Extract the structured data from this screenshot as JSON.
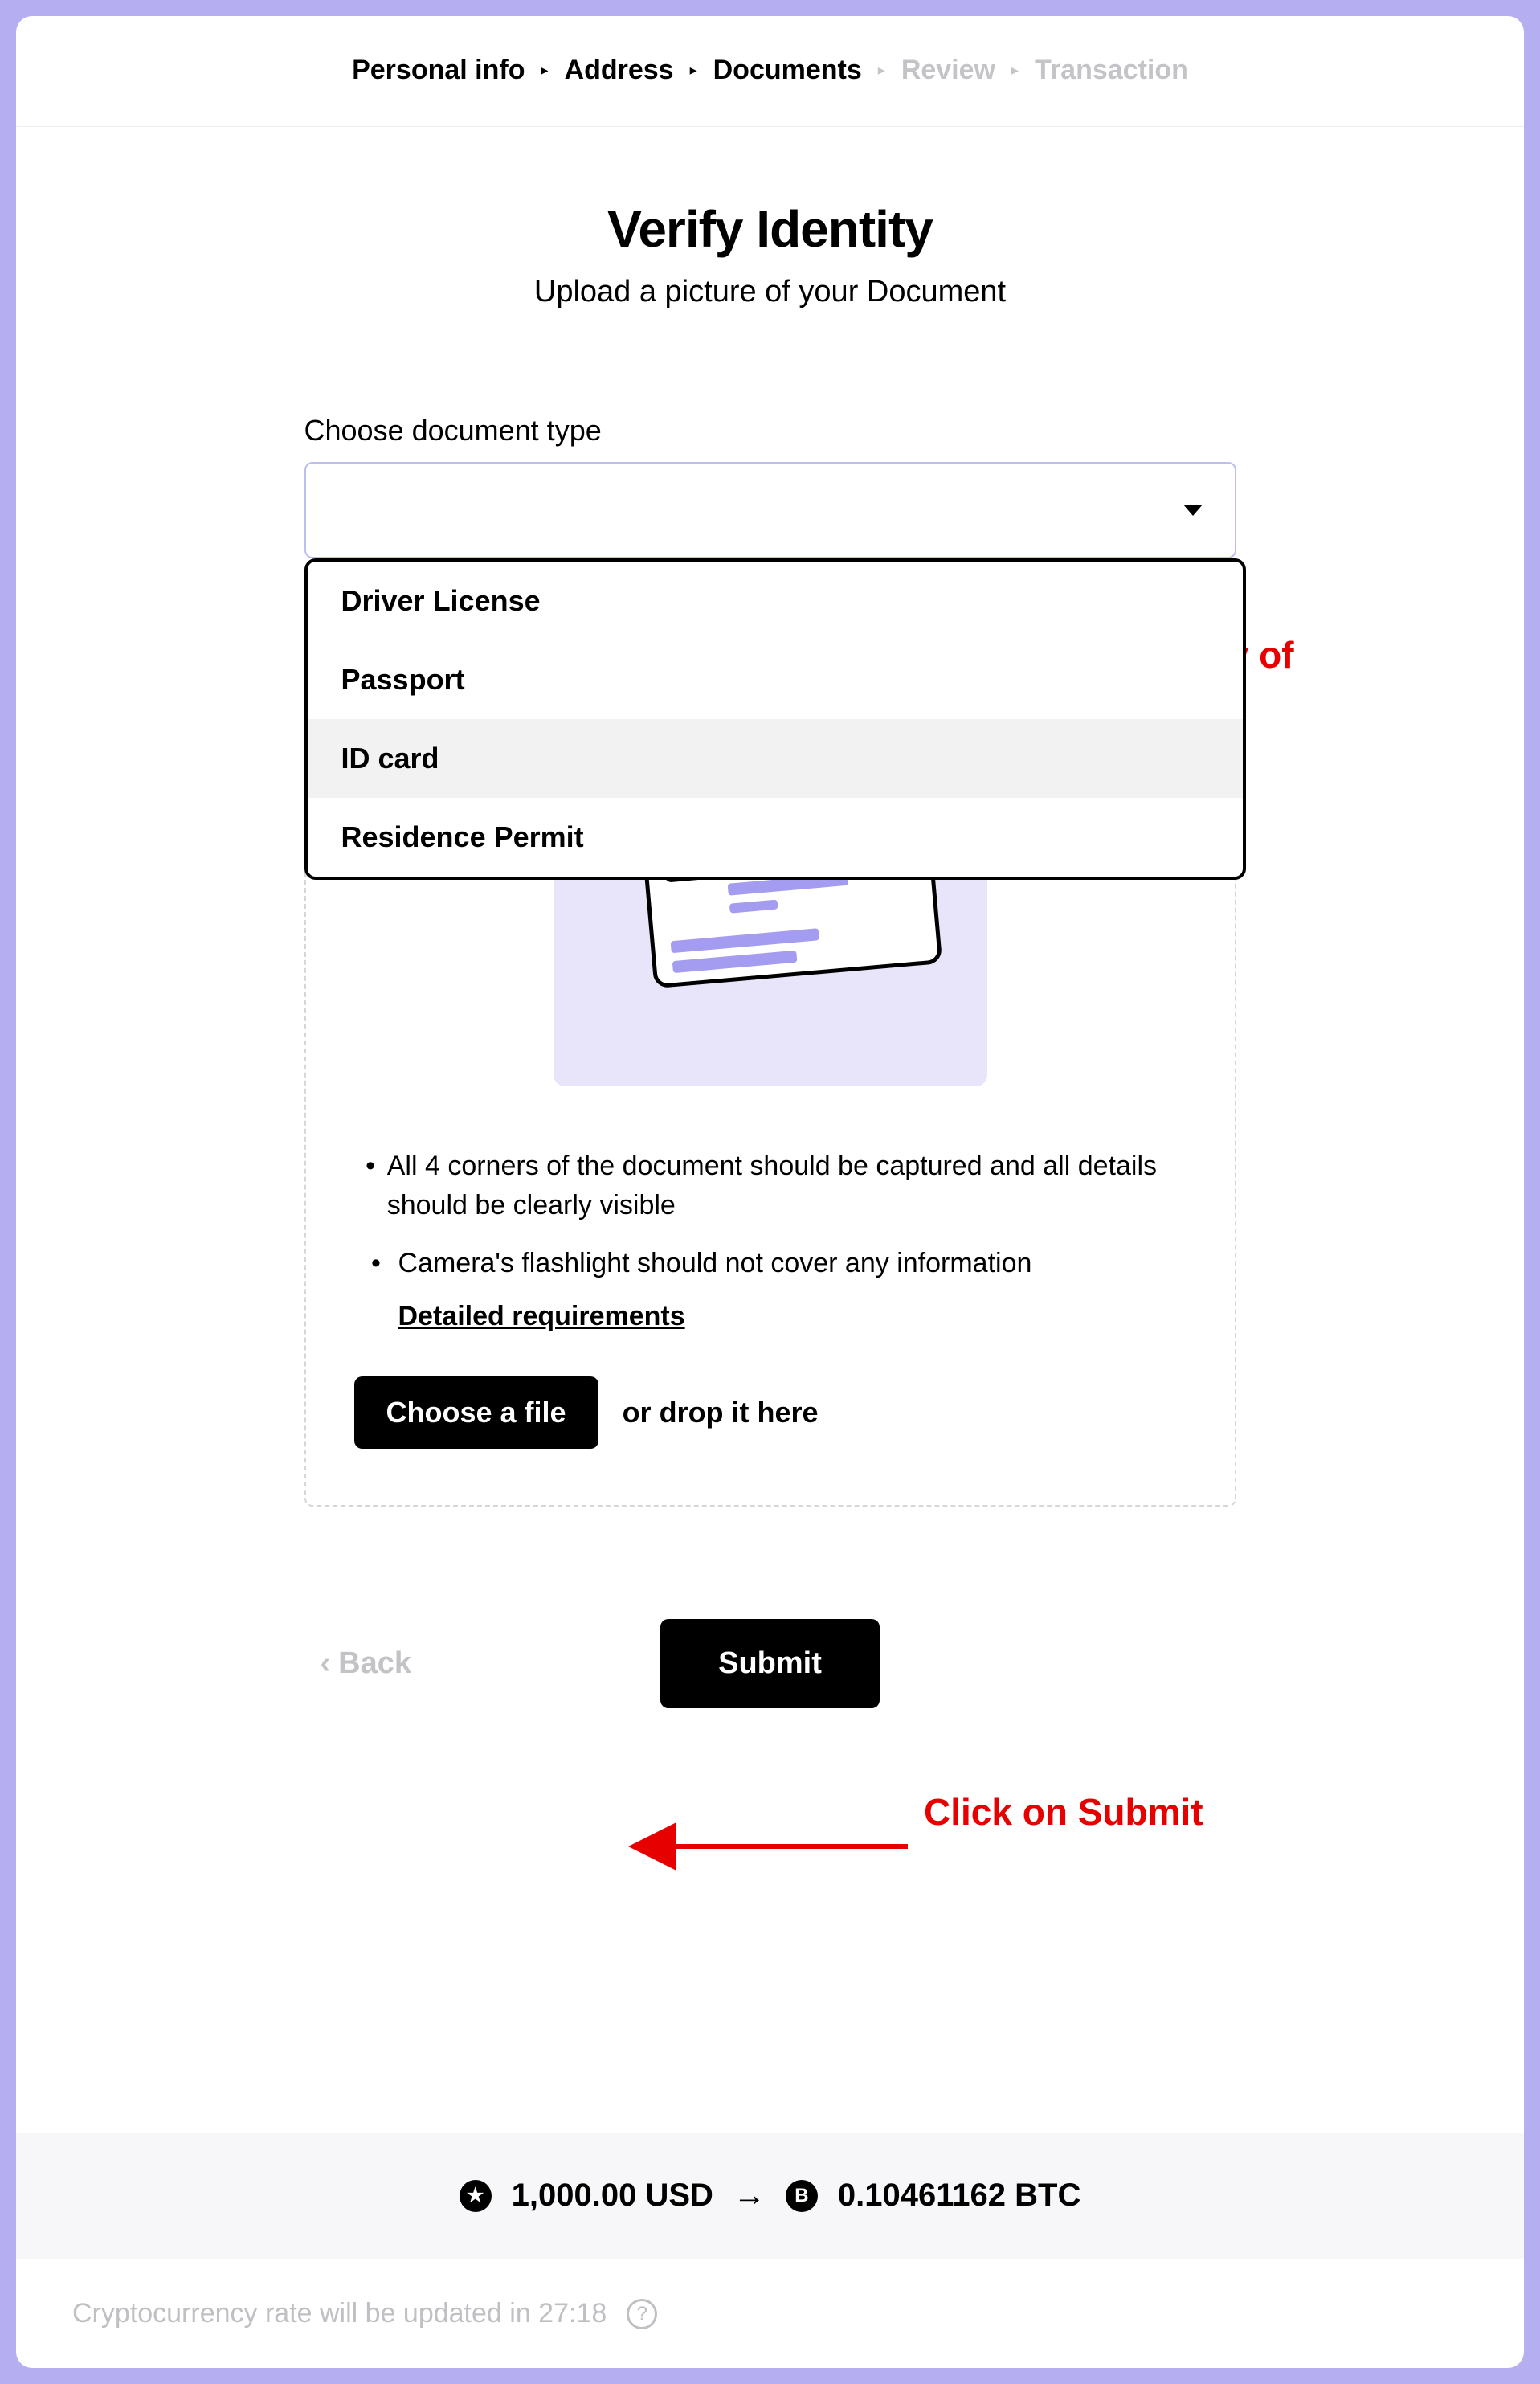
{
  "breadcrumb": {
    "steps": [
      "Personal info",
      "Address",
      "Documents",
      "Review",
      "Transaction"
    ],
    "activeCount": 3
  },
  "header": {
    "title": "Verify Identity",
    "subtitle": "Upload a picture of your Document"
  },
  "docType": {
    "label": "Choose document type",
    "options": [
      "Driver License",
      "Passport",
      "ID card",
      "Residence Permit"
    ],
    "highlightIndex": 2
  },
  "upload": {
    "req1": "All 4 corners of the document should be captured and all details should be clearly visible",
    "req2": "Camera's flashlight should not cover any information",
    "detailLink": "Detailed requirements",
    "chooseBtn": "Choose a file",
    "dropText": "or drop it here"
  },
  "nav": {
    "back": "Back",
    "submit": "Submit"
  },
  "rate": {
    "fromAmount": "1,000.00 USD",
    "toAmount": "0.10461162 BTC",
    "fromIcon": "★",
    "toIcon": "B"
  },
  "status": {
    "text": "Cryptocurrency rate will be updated in 27:18"
  },
  "annotations": {
    "a1": "Upload a copy of your ID",
    "a2": "Click on Submit"
  }
}
